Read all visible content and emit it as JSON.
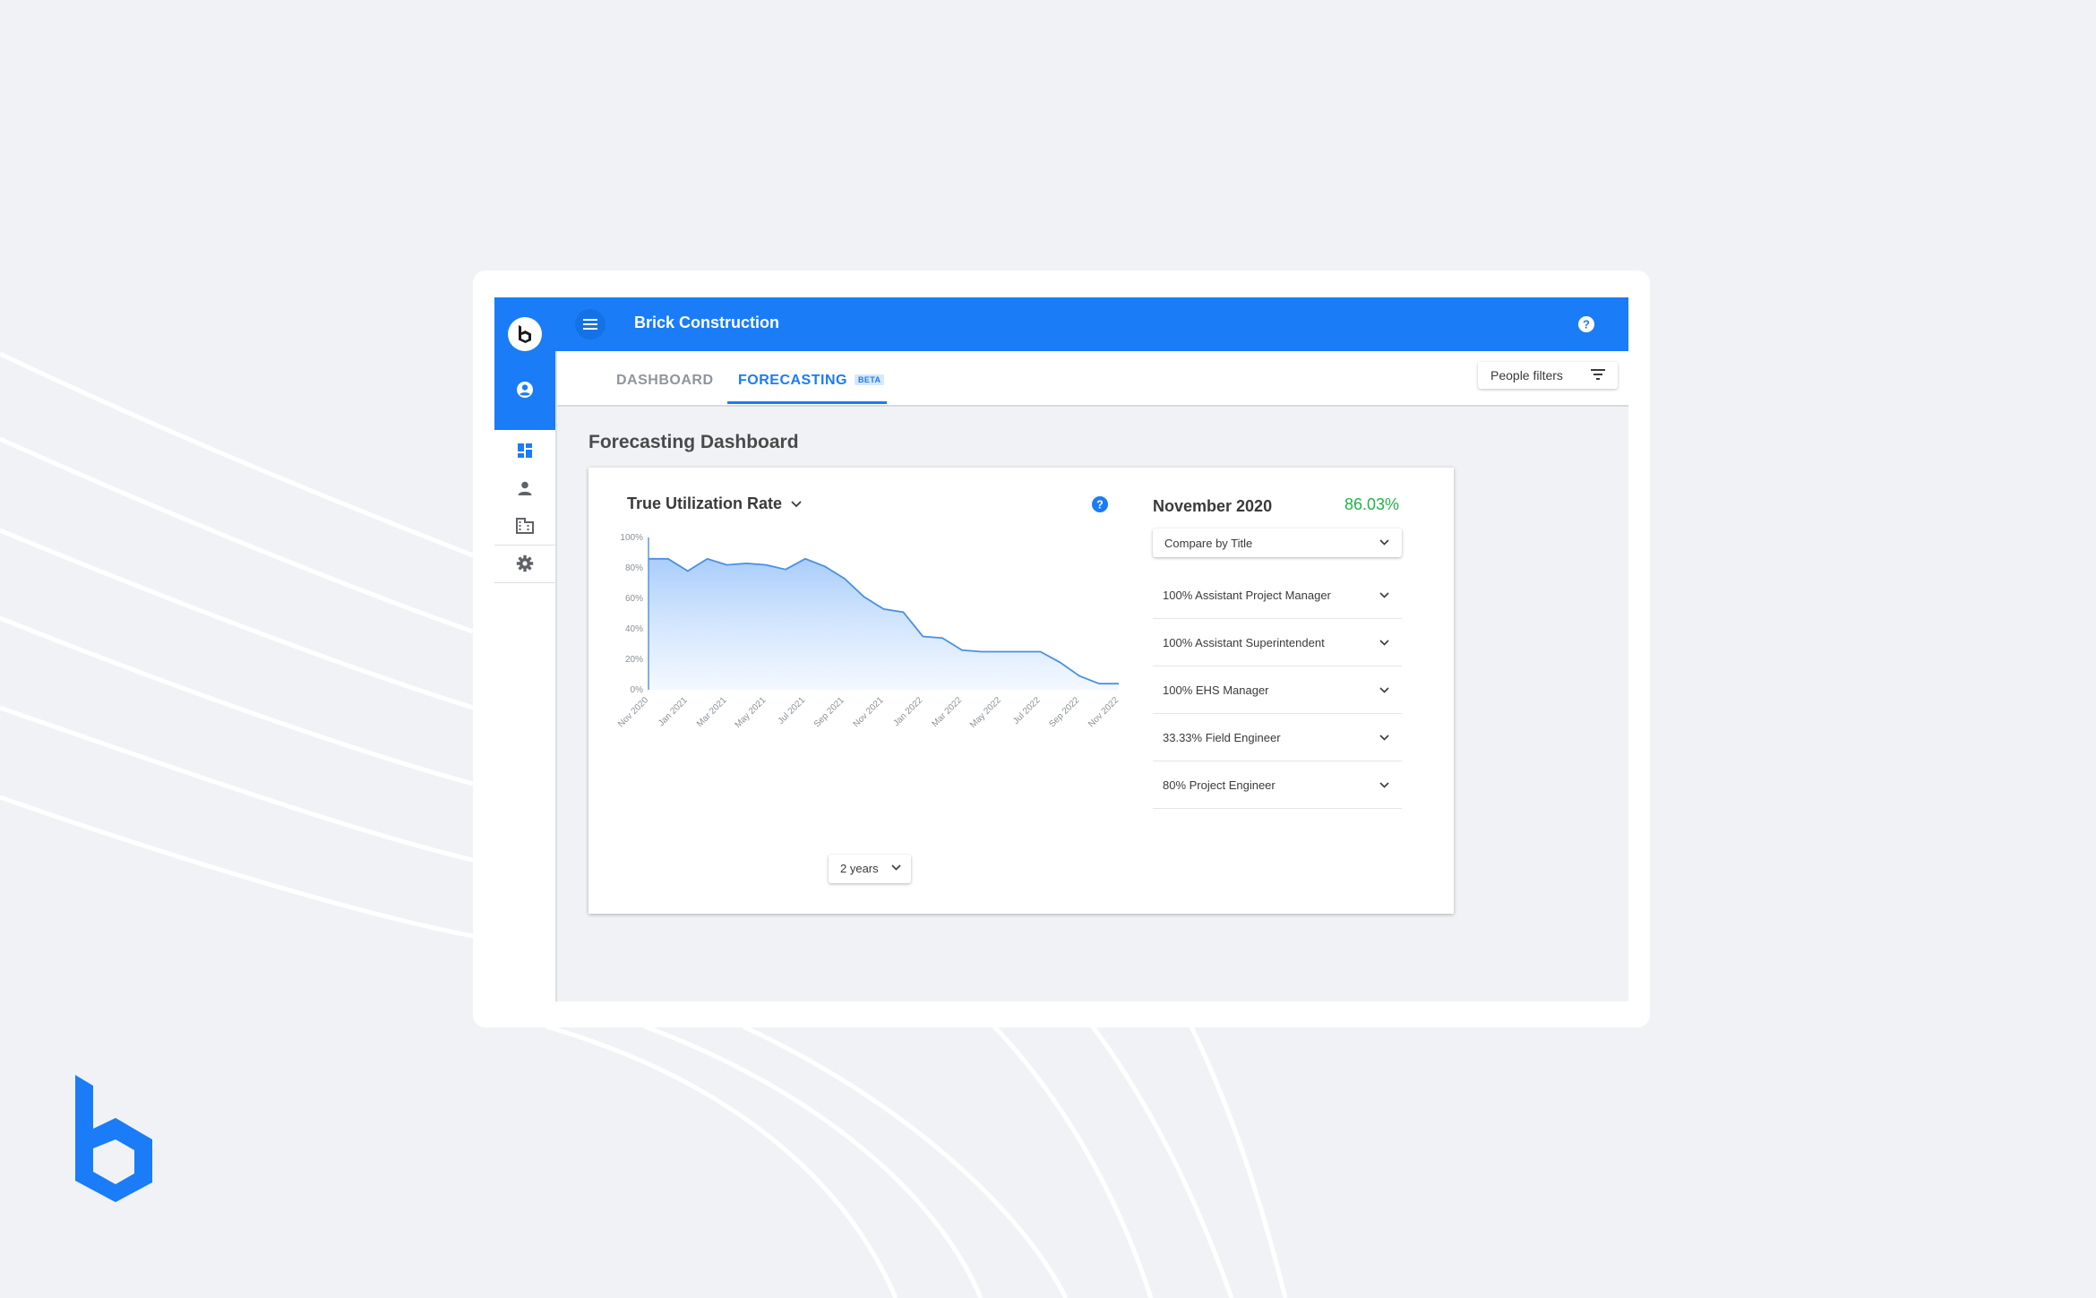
{
  "app": {
    "title": "Brick Construction",
    "brand_color": "#1a7cf7"
  },
  "rail": {
    "icons": [
      "brick-logo-icon",
      "account-circle-icon",
      "dashboard-icon",
      "person-icon",
      "building-icon",
      "gear-icon"
    ]
  },
  "tabs": {
    "dashboard": "DASHBOARD",
    "forecasting": "FORECASTING",
    "beta_badge": "BETA",
    "active": "forecasting"
  },
  "people_filters": {
    "label": "People filters"
  },
  "page": {
    "title": "Forecasting Dashboard"
  },
  "metric": {
    "label": "True Utilization Rate"
  },
  "range": {
    "label": "2 years"
  },
  "detail": {
    "month": "November 2020",
    "value": "86.03%",
    "value_color": "#22b14c",
    "compare_label": "Compare by Title",
    "rows": [
      "100% Assistant Project Manager",
      "100% Assistant Superintendent",
      "100% EHS Manager",
      "33.33% Field Engineer",
      "80% Project Engineer"
    ]
  },
  "chart_data": {
    "type": "area",
    "title": "True Utilization Rate",
    "x": [
      "Nov 2020",
      "Dec 2020",
      "Jan 2021",
      "Feb 2021",
      "Mar 2021",
      "Apr 2021",
      "May 2021",
      "Jun 2021",
      "Jul 2021",
      "Aug 2021",
      "Sep 2021",
      "Oct 2021",
      "Nov 2021",
      "Dec 2021",
      "Jan 2022",
      "Feb 2022",
      "Mar 2022",
      "Apr 2022",
      "May 2022",
      "Jun 2022",
      "Jul 2022",
      "Aug 2022",
      "Sep 2022",
      "Oct 2022",
      "Nov 2022"
    ],
    "values": [
      86,
      86,
      78,
      86,
      82,
      83,
      82,
      79,
      86,
      81,
      73,
      61,
      53,
      51,
      35,
      34,
      26,
      25,
      25,
      25,
      25,
      18,
      9,
      4,
      4
    ],
    "x_tick_labels": [
      "Nov 2020",
      "Jan 2021",
      "Mar 2021",
      "May 2021",
      "Jul 2021",
      "Sep 2021",
      "Nov 2021",
      "Jan 2022",
      "Mar 2022",
      "May 2022",
      "Jul 2022",
      "Sep 2022",
      "Nov 2022"
    ],
    "y_tick_labels": [
      "0%",
      "20%",
      "40%",
      "60%",
      "80%",
      "100%"
    ],
    "ylim": [
      0,
      100
    ],
    "grid": false,
    "line_color": "#4a90e2"
  }
}
